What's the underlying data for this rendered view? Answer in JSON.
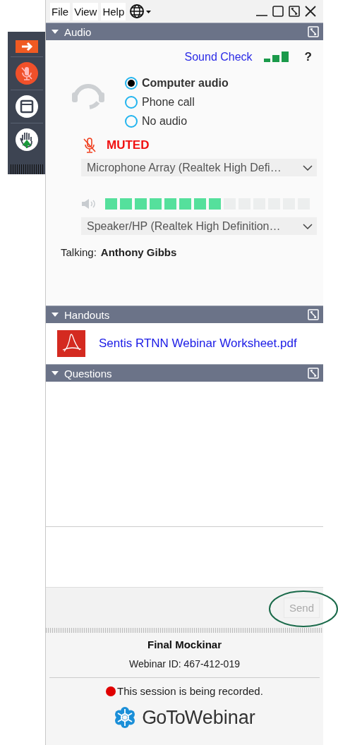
{
  "menu": [
    {
      "label": "File"
    },
    {
      "label": "View"
    },
    {
      "label": "Help"
    }
  ],
  "audio": {
    "title": "Audio",
    "expanded": true,
    "sound_check": "Sound Check",
    "help": "?",
    "options": [
      {
        "label": "Computer audio",
        "selected": true
      },
      {
        "label": "Phone call",
        "selected": false
      },
      {
        "label": "No audio",
        "selected": false
      }
    ],
    "muted": true,
    "muted_label": "MUTED",
    "microphone": "Microphone Array (Realtek High Defi…",
    "speaker_meter": {
      "level": 0.57
    },
    "speaker": "Speaker/HP (Realtek High Definition…",
    "talking_label": "Talking:",
    "talking_name": "Anthony Gibbs"
  },
  "handouts": {
    "title": "Handouts",
    "expanded": true,
    "files": [
      {
        "name": "Sentis RTNN Webinar Worksheet.pdf"
      }
    ]
  },
  "questions": {
    "title": "Questions",
    "expanded": true,
    "send": "Send",
    "send_disabled": true
  },
  "footer": {
    "title": "Final Mockinar",
    "webinar_id": "Webinar ID: 467-412-019",
    "recording": "This session is being recorded.",
    "logo_bold": "GoTo",
    "logo_light": "Webinar"
  }
}
